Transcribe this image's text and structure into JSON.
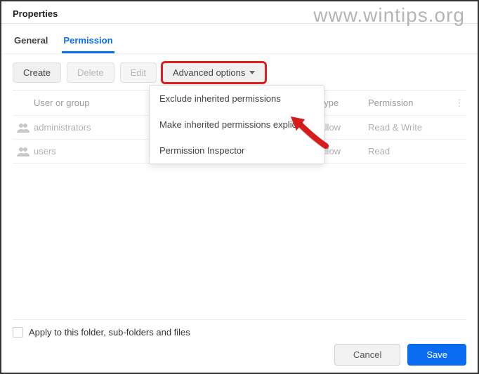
{
  "watermark": "www.wintips.org",
  "header": {
    "title": "Properties"
  },
  "tabs": {
    "general": "General",
    "permission": "Permission"
  },
  "toolbar": {
    "create": "Create",
    "delete": "Delete",
    "edit": "Edit",
    "advanced": "Advanced options"
  },
  "dropdown": {
    "exclude": "Exclude inherited permissions",
    "make_explicit": "Make inherited permissions explicit",
    "inspector": "Permission Inspector"
  },
  "table": {
    "headers": {
      "user": "User or group",
      "type": "Type",
      "permission": "Permission"
    },
    "rows": [
      {
        "name": "administrators",
        "type": "Allow",
        "permission": "Read & Write"
      },
      {
        "name": "users",
        "type": "Allow",
        "permission": "Read"
      }
    ],
    "more": "⋮"
  },
  "footer": {
    "apply_label": "Apply to this folder, sub-folders and files"
  },
  "actions": {
    "cancel": "Cancel",
    "save": "Save"
  }
}
